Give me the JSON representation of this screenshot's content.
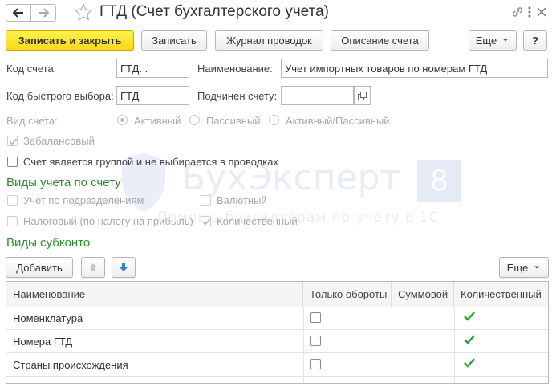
{
  "window": {
    "title": "ГТД (Счет бухгалтерского учета)"
  },
  "toolbar": {
    "save_close": "Записать и закрыть",
    "save": "Записать",
    "journal": "Журнал проводок",
    "description": "Описание счета",
    "more": "Еще",
    "help": "?"
  },
  "form": {
    "code_label": "Код счета:",
    "code_value": "ГТД.  .",
    "name_label": "Наименование:",
    "name_value": "Учет импортных товаров по номерам ГТД",
    "quick_code_label": "Код быстрого выбора:",
    "quick_code_value": "ГТД",
    "parent_label": "Подчинен счету:",
    "parent_value": "",
    "type_label": "Вид счета:",
    "type_options": [
      "Активный",
      "Пассивный",
      "Активный/Пассивный"
    ],
    "type_selected": "Активный",
    "off_balance_label": "Забалансовый",
    "off_balance_checked": true,
    "group_label": "Счет является группой и не выбирается в проводках",
    "group_checked": false
  },
  "accounting_kinds": {
    "title": "Виды учета по счету",
    "by_division": "Учет по подразделениям",
    "by_division_checked": false,
    "currency": "Валютный",
    "currency_checked": false,
    "tax": "Налоговый (по налогу на прибыль)",
    "tax_checked": false,
    "quantity": "Количественный",
    "quantity_checked": true
  },
  "subconto": {
    "title": "Виды субконто",
    "add_label": "Добавить",
    "more_label": "Еще",
    "columns": [
      "Наименование",
      "Только обороты",
      "Суммовой",
      "Количественный"
    ],
    "rows": [
      {
        "name": "Номенклатура",
        "turnover_only": false,
        "sum": false,
        "quantity": true
      },
      {
        "name": "Номера ГТД",
        "turnover_only": false,
        "sum": false,
        "quantity": true
      },
      {
        "name": "Страны происхождения",
        "turnover_only": false,
        "sum": false,
        "quantity": true
      }
    ]
  },
  "watermark": {
    "brand": "БухЭксперт",
    "number": "8",
    "tagline": "Помощь бухгалтерам по учету в 1С"
  },
  "colors": {
    "primary_button": "#f9d81d",
    "section_title": "#2e8b2e",
    "check_green": "#2ca02c",
    "watermark": "#b8c8e6"
  }
}
